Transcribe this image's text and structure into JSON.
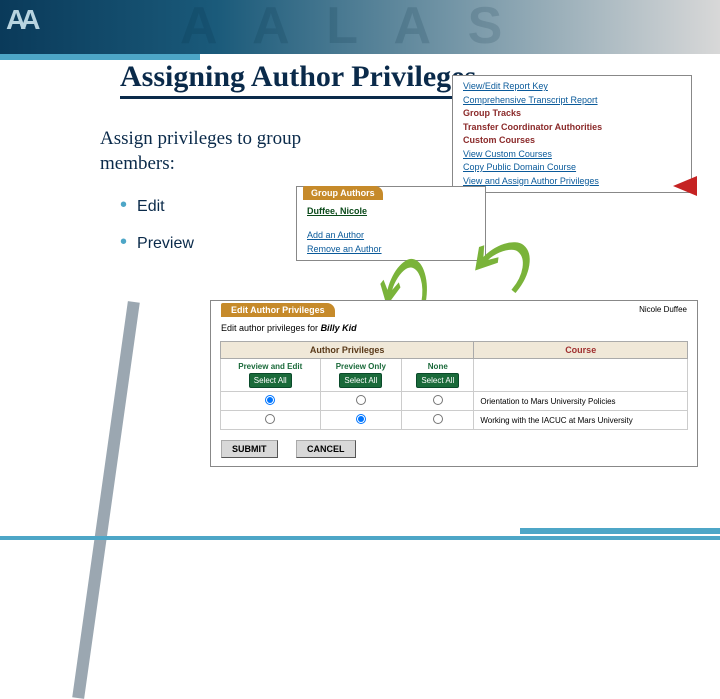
{
  "banner": {
    "logo": "AA",
    "watermark": "A A L A S"
  },
  "title": "Assigning Author Privileges",
  "intro": "Assign privileges to group members:",
  "bullets": [
    "Edit",
    "Preview"
  ],
  "menu": {
    "items": [
      "View/Edit Report Key",
      "Comprehensive Transcript Report"
    ],
    "headers": [
      "Group Tracks",
      "Transfer Coordinator Authorities",
      "Custom Courses"
    ],
    "custom_items": [
      "View Custom Courses",
      "Copy Public Domain Course",
      "View and Assign Author Privileges"
    ]
  },
  "authors_panel": {
    "tab": "Group Authors",
    "name": "Duffee, Nicole",
    "links": [
      "Add an Author",
      "Remove an Author"
    ]
  },
  "priv_panel": {
    "tab": "Edit Author Privileges",
    "user": "Nicole Duffee",
    "subtitle_prefix": "Edit author privileges for ",
    "subtitle_name": "Billy Kid",
    "header_priv": "Author Privileges",
    "header_course": "Course",
    "cols": [
      "Preview and Edit",
      "Preview Only",
      "None"
    ],
    "select_all": "Select All",
    "rows": [
      {
        "course": "Orientation to Mars University Policies",
        "sel": 0
      },
      {
        "course": "Working with the IACUC at Mars University",
        "sel": 1
      }
    ],
    "submit": "SUBMIT",
    "cancel": "CANCEL"
  }
}
